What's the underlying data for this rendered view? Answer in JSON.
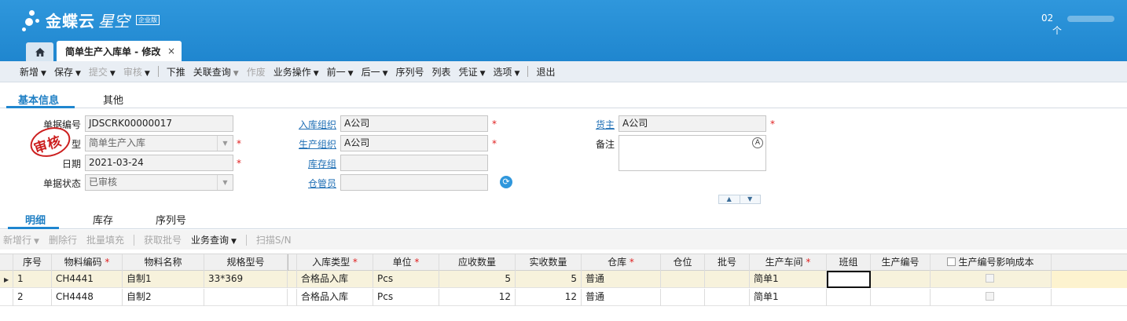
{
  "app": {
    "brand": "金蝶云",
    "brand_suffix": "星空",
    "edition_badge": "企业版",
    "user_text": "02",
    "header_extra": "个"
  },
  "tabs": {
    "home_icon": "home-icon",
    "document_tab": "简单生产入库单 - 修改",
    "close_glyph": "×"
  },
  "toolbar": {
    "new": "新增",
    "save": "保存",
    "submit": "提交",
    "audit": "审核",
    "push": "下推",
    "linked_query": "关联查询",
    "void": "作废",
    "business_ops": "业务操作",
    "prev": "前一",
    "next": "后一",
    "serial_no": "序列号",
    "list": "列表",
    "voucher": "凭证",
    "options": "选项",
    "exit": "退出"
  },
  "page_tabs": [
    "基本信息",
    "其他"
  ],
  "form": {
    "doc_no_label": "单据编号",
    "doc_no": "JDSCRK00000017",
    "doc_type_label": "型",
    "doc_type": "简单生产入库",
    "date_label": "日期",
    "date": "2021-03-24",
    "status_label": "单据状态",
    "status": "已审核",
    "in_org_label": "入库组织",
    "in_org": "A公司",
    "prod_org_label": "生产组织",
    "prod_org": "A公司",
    "stock_group_label": "库存组",
    "stock_group": "",
    "keeper_label": "仓管员",
    "keeper": "",
    "owner_label": "货主",
    "owner": "A公司",
    "remark_label": "备注",
    "remark": "",
    "required_mark": "*",
    "stamp_text": "审核"
  },
  "detail_tabs": [
    "明细",
    "库存",
    "序列号"
  ],
  "detail_toolbar": {
    "add_row": "新增行",
    "delete_row": "删除行",
    "batch_fill": "批量填充",
    "get_batch": "获取批号",
    "biz_query": "业务查询",
    "scan_sn": "扫描S/N"
  },
  "grid": {
    "headers": {
      "seq": "序号",
      "material_code": "物料编码",
      "material_name": "物料名称",
      "spec": "规格型号",
      "in_type": "入库类型",
      "unit": "单位",
      "due_qty": "应收数量",
      "real_qty": "实收数量",
      "warehouse": "仓库",
      "location": "仓位",
      "batch": "批号",
      "workshop": "生产车间",
      "shift": "班组",
      "prod_no": "生产编号",
      "cost_affect": "生产编号影响成本"
    },
    "required_mark": "*",
    "rows": [
      {
        "seq": "1",
        "material_code": "CH4441",
        "material_name": "自制1",
        "spec": "33*369",
        "in_type": "合格品入库",
        "unit": "Pcs",
        "due_qty": "5",
        "real_qty": "5",
        "warehouse": "普通",
        "location": "",
        "batch": "",
        "workshop": "简单1",
        "shift": "",
        "prod_no": ""
      },
      {
        "seq": "2",
        "material_code": "CH4448",
        "material_name": "自制2",
        "spec": "",
        "in_type": "合格品入库",
        "unit": "Pcs",
        "due_qty": "12",
        "real_qty": "12",
        "warehouse": "普通",
        "location": "",
        "batch": "",
        "workshop": "简单1",
        "shift": "",
        "prod_no": ""
      }
    ]
  }
}
